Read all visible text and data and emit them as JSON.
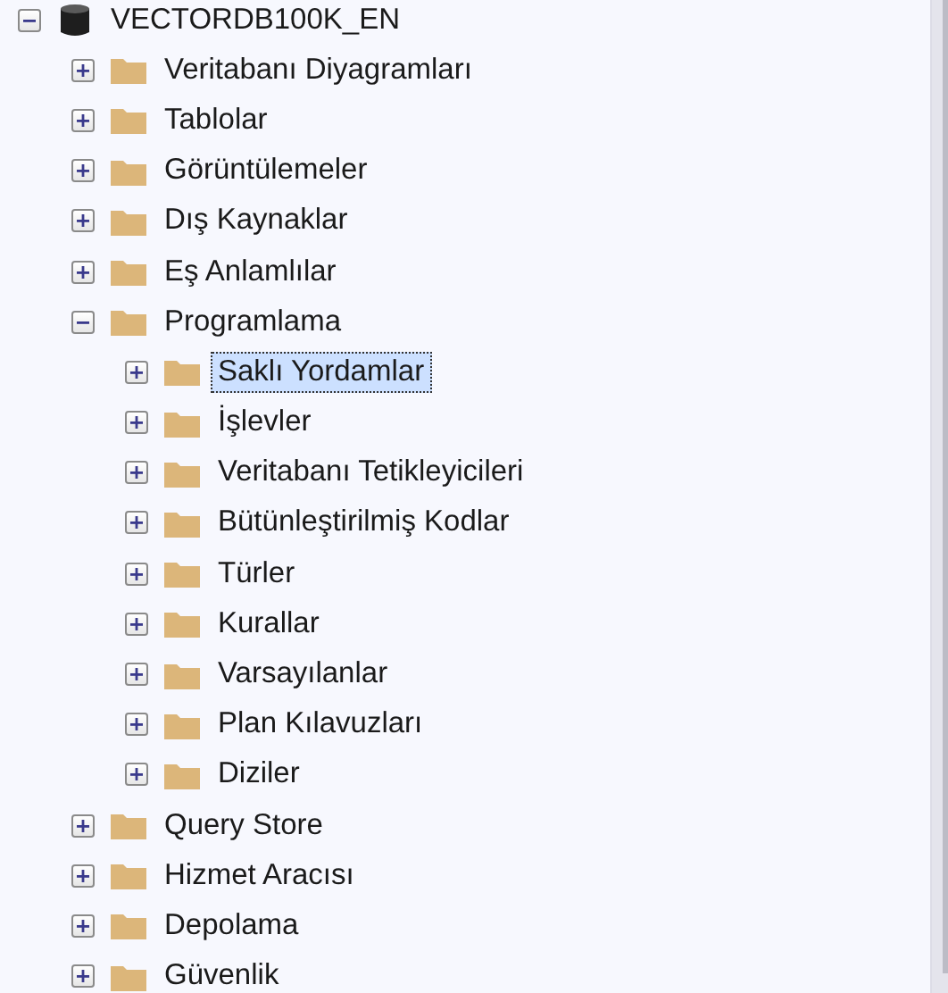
{
  "tree": [
    {
      "label": "VECTORDB100K_EN",
      "kind": "database",
      "expanded": true,
      "selected": false,
      "children": [
        {
          "label": "Veritabanı Diyagramları",
          "kind": "folder",
          "expanded": false,
          "selected": false
        },
        {
          "label": "Tablolar",
          "kind": "folder",
          "expanded": false,
          "selected": false
        },
        {
          "label": "Görüntülemeler",
          "kind": "folder",
          "expanded": false,
          "selected": false
        },
        {
          "label": "Dış Kaynaklar",
          "kind": "folder",
          "expanded": false,
          "selected": false
        },
        {
          "label": "Eş Anlamlılar",
          "kind": "folder",
          "expanded": false,
          "selected": false
        },
        {
          "label": "Programlama",
          "kind": "folder",
          "expanded": true,
          "selected": false,
          "children": [
            {
              "label": "Saklı Yordamlar",
              "kind": "folder",
              "expanded": false,
              "selected": true
            },
            {
              "label": "İşlevler",
              "kind": "folder",
              "expanded": false,
              "selected": false
            },
            {
              "label": "Veritabanı Tetikleyicileri",
              "kind": "folder",
              "expanded": false,
              "selected": false
            },
            {
              "label": "Bütünleştirilmiş Kodlar",
              "kind": "folder",
              "expanded": false,
              "selected": false
            },
            {
              "label": "Türler",
              "kind": "folder",
              "expanded": false,
              "selected": false
            },
            {
              "label": "Kurallar",
              "kind": "folder",
              "expanded": false,
              "selected": false
            },
            {
              "label": "Varsayılanlar",
              "kind": "folder",
              "expanded": false,
              "selected": false
            },
            {
              "label": "Plan Kılavuzları",
              "kind": "folder",
              "expanded": false,
              "selected": false
            },
            {
              "label": "Diziler",
              "kind": "folder",
              "expanded": false,
              "selected": false
            }
          ]
        },
        {
          "label": "Query Store",
          "kind": "folder",
          "expanded": false,
          "selected": false
        },
        {
          "label": "Hizmet Aracısı",
          "kind": "folder",
          "expanded": false,
          "selected": false
        },
        {
          "label": "Depolama",
          "kind": "folder",
          "expanded": false,
          "selected": false
        },
        {
          "label": "Güvenlik",
          "kind": "folder",
          "expanded": false,
          "selected": false
        }
      ]
    }
  ]
}
